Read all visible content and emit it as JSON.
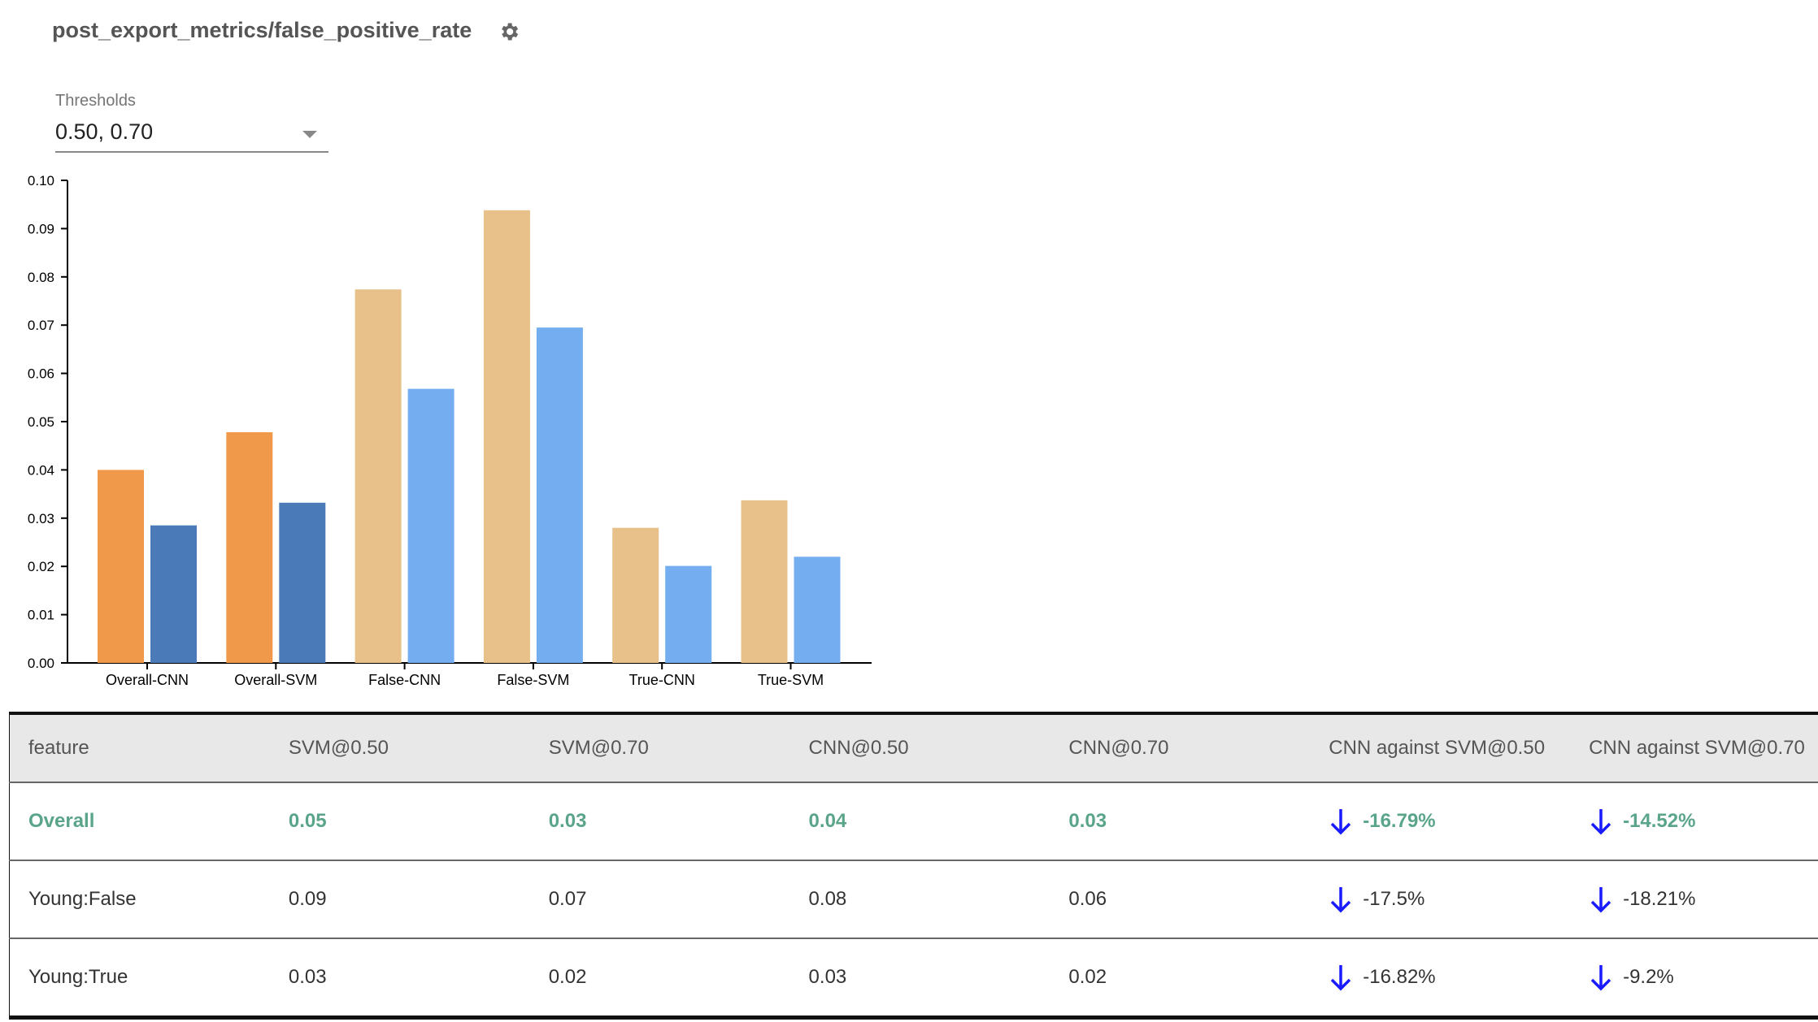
{
  "header": {
    "title": "post_export_metrics/false_positive_rate",
    "settings_icon": "gear-icon"
  },
  "thresholds": {
    "label": "Thresholds",
    "value": "0.50, 0.70"
  },
  "chart_data": {
    "type": "bar",
    "categories": [
      "Overall-CNN",
      "Overall-SVM",
      "False-CNN",
      "False-SVM",
      "True-CNN",
      "True-SVM"
    ],
    "series": [
      {
        "values": [
          0.04,
          0.0478,
          0.0774,
          0.0938,
          0.028,
          0.0337
        ],
        "colors": [
          "#F0994B",
          "#F0994B",
          "#E8C08A",
          "#E8C08A",
          "#E8C08A",
          "#E8C08A"
        ]
      },
      {
        "values": [
          0.0285,
          0.0332,
          0.0568,
          0.0695,
          0.0201,
          0.022
        ],
        "colors": [
          "#4A7AB8",
          "#4A7AB8",
          "#74AEF0",
          "#74AEF0",
          "#74AEF0",
          "#74AEF0"
        ]
      }
    ],
    "ylim": [
      0,
      0.1
    ],
    "yticks": [
      "0.00",
      "0.01",
      "0.02",
      "0.03",
      "0.04",
      "0.05",
      "0.06",
      "0.07",
      "0.08",
      "0.09",
      "0.10"
    ],
    "grid": false
  },
  "table": {
    "headers": [
      "feature",
      "SVM@0.50",
      "SVM@0.70",
      "CNN@0.50",
      "CNN@0.70",
      "CNN against SVM@0.50",
      "CNN against SVM@0.70"
    ],
    "rows": [
      {
        "cells": [
          "Overall",
          "0.05",
          "0.03",
          "0.04",
          "0.03",
          "-16.79%",
          "-14.52%"
        ],
        "highlight": true
      },
      {
        "cells": [
          "Young:False",
          "0.09",
          "0.07",
          "0.08",
          "0.06",
          "-17.5%",
          "-18.21%"
        ]
      },
      {
        "cells": [
          "Young:True",
          "0.03",
          "0.02",
          "0.03",
          "0.02",
          "-16.82%",
          "-9.2%"
        ]
      }
    ],
    "delta_icon": "arrow-down-icon",
    "colors": {
      "highlight": "#5aa58a",
      "arrow": "#1a1aff"
    }
  }
}
